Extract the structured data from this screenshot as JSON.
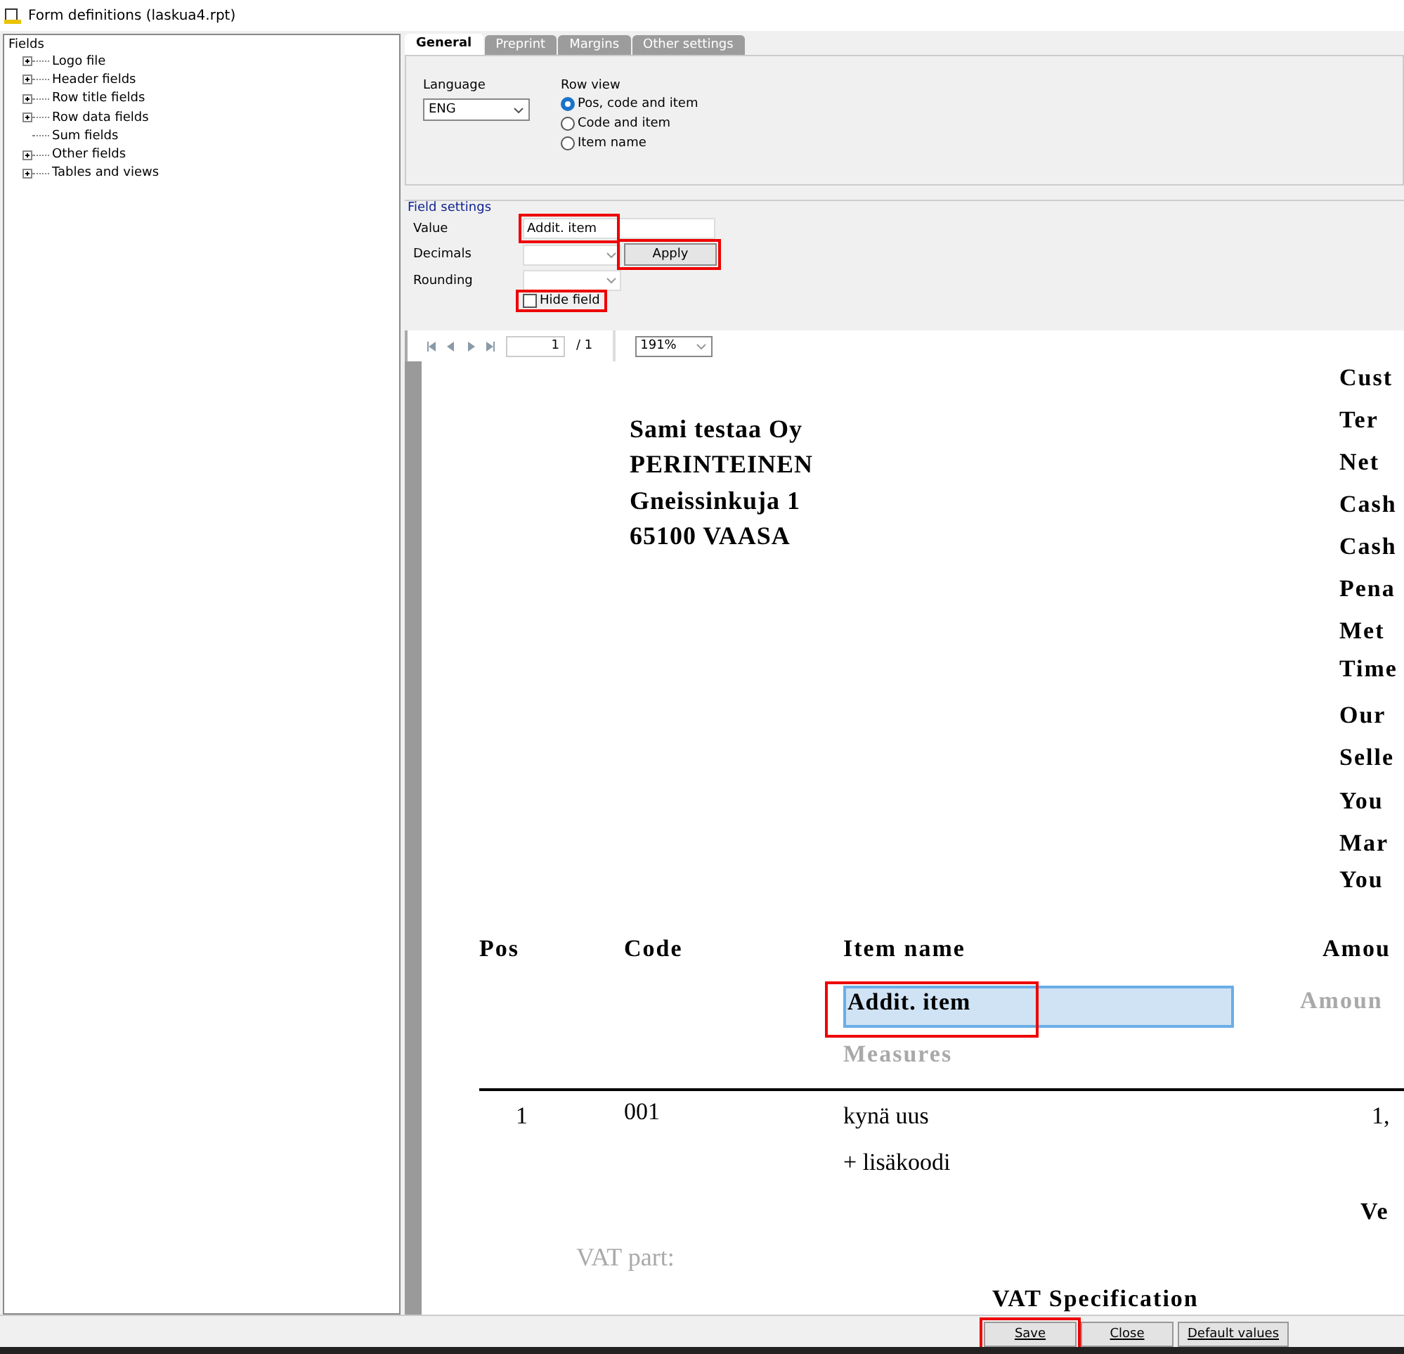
{
  "window": {
    "title": "Form definitions (laskua4.rpt)"
  },
  "tree": {
    "root": "Fields",
    "items": [
      {
        "label": "Logo file",
        "expandable": true
      },
      {
        "label": "Header fields",
        "expandable": true
      },
      {
        "label": "Row title fields",
        "expandable": true
      },
      {
        "label": "Row data fields",
        "expandable": true
      },
      {
        "label": "Sum fields",
        "expandable": false
      },
      {
        "label": "Other fields",
        "expandable": true
      },
      {
        "label": "Tables and views",
        "expandable": true
      }
    ]
  },
  "tabs": [
    {
      "label": "General",
      "selected": true
    },
    {
      "label": "Preprint",
      "selected": false
    },
    {
      "label": "Margins",
      "selected": false
    },
    {
      "label": "Other settings",
      "selected": false
    }
  ],
  "general": {
    "language_label": "Language",
    "language": "ENG",
    "row_view_label": "Row view",
    "row_view": [
      {
        "label": "Pos, code and item",
        "selected": true
      },
      {
        "label": "Code and item",
        "selected": false
      },
      {
        "label": "Item name",
        "selected": false
      }
    ]
  },
  "field_settings": {
    "title": "Field settings",
    "value_label": "Value",
    "value": "Addit. item",
    "value_highlighted": true,
    "decimals_label": "Decimals",
    "rounding_label": "Rounding",
    "apply": "Apply",
    "apply_highlighted": true,
    "hide_field": "Hide field",
    "hide_checked": false,
    "hide_highlighted": true
  },
  "preview": {
    "page": "1",
    "page_total": "/ 1",
    "zoom": "191%",
    "items": [
      {
        "text": "Sami testaa Oy",
        "kind": "address"
      },
      {
        "text": "PERINTEINEN",
        "kind": "address"
      },
      {
        "text": "Gneissinkuja 1",
        "kind": "address"
      },
      {
        "text": "65100 VAASA",
        "kind": "address"
      },
      {
        "text": "Cust",
        "kind": "heading"
      },
      {
        "text": "Ter",
        "kind": "heading"
      },
      {
        "text": "Net",
        "kind": "heading"
      },
      {
        "text": "Cash",
        "kind": "heading"
      },
      {
        "text": "Cash",
        "kind": "heading"
      },
      {
        "text": "Pena",
        "kind": "heading"
      },
      {
        "text": "Met",
        "kind": "heading"
      },
      {
        "text": "Time",
        "kind": "heading"
      },
      {
        "text": "Our",
        "kind": "heading"
      },
      {
        "text": "Selle",
        "kind": "heading"
      },
      {
        "text": "You",
        "kind": "heading"
      },
      {
        "text": "Mar",
        "kind": "heading"
      },
      {
        "text": "You",
        "kind": "heading"
      },
      {
        "text": "Pos",
        "kind": "heading"
      },
      {
        "text": "Code",
        "kind": "heading"
      },
      {
        "text": "Item name",
        "kind": "heading"
      },
      {
        "text": "Amou",
        "kind": "heading"
      },
      {
        "text": "Addit. item",
        "kind": "selected"
      },
      {
        "text": "Amoun",
        "kind": "faded"
      },
      {
        "text": "Measures",
        "kind": "faded"
      },
      {
        "text": "1",
        "kind": "plain"
      },
      {
        "text": "001",
        "kind": "plain"
      },
      {
        "text": "kynä uus",
        "kind": "plain"
      },
      {
        "text": "1,",
        "kind": "plain"
      },
      {
        "text": "+ lisäkoodi",
        "kind": "plain"
      },
      {
        "text": "Ve",
        "kind": "heading"
      },
      {
        "text": "VAT part:",
        "kind": "fadedplain"
      },
      {
        "text": "VAT Specification",
        "kind": "heading"
      }
    ],
    "selected_highlighted": true
  },
  "buttons": [
    {
      "label": "Save",
      "highlighted": true
    },
    {
      "label": "Close",
      "highlighted": false
    },
    {
      "label": "Default values",
      "highlighted": false
    }
  ]
}
